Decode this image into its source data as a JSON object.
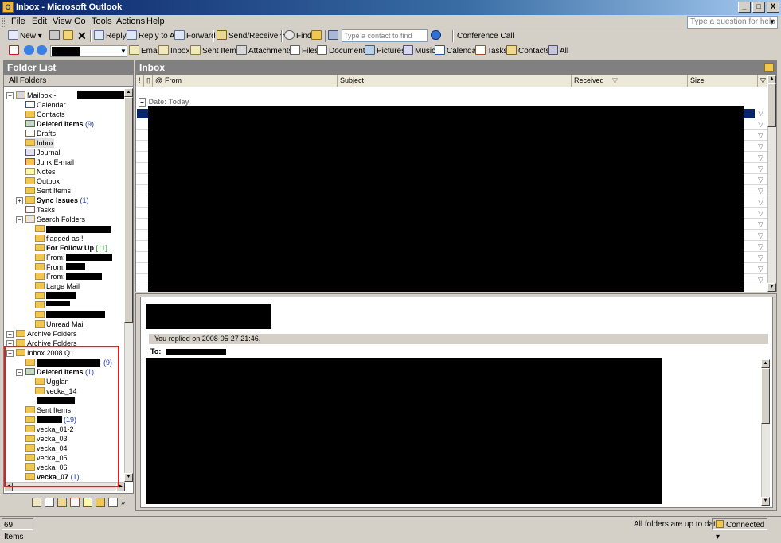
{
  "window": {
    "title": "Inbox - Microsoft Outlook",
    "min": "_",
    "max": "□",
    "close": "X"
  },
  "menu": {
    "items": [
      "File",
      "Edit",
      "View",
      "Go",
      "Tools",
      "Actions",
      "Help"
    ],
    "ask_placeholder": "Type a question for help"
  },
  "toolbar": {
    "new": "New",
    "reply": "Reply",
    "reply_all": "Reply to All",
    "forward": "Forward",
    "send_receive": "Send/Receive",
    "find": "Find",
    "contact_placeholder": "Type a contact to find",
    "conference": "Conference Call"
  },
  "navbar": {
    "items": [
      "Email",
      "Inbox",
      "Sent Items",
      "Attachments",
      "Files",
      "Documents",
      "Pictures",
      "Music",
      "Calendar",
      "Tasks",
      "Contacts",
      "All"
    ]
  },
  "folder_pane": {
    "title": "Folder List",
    "subtitle": "All Folders",
    "mailbox": "Mailbox -",
    "items": {
      "calendar": "Calendar",
      "contacts": "Contacts",
      "deleted": "Deleted Items",
      "deleted_count": "(9)",
      "drafts": "Drafts",
      "inbox": "Inbox",
      "journal": "Journal",
      "junk": "Junk E-mail",
      "notes": "Notes",
      "outbox": "Outbox",
      "sent": "Sent Items",
      "sync": "Sync Issues",
      "sync_count": "(1)",
      "tasks": "Tasks",
      "search": "Search Folders",
      "flagged": "flagged as !",
      "followup": "For Follow Up",
      "followup_count": "[11]",
      "from1": "From:",
      "from2": "From:",
      "from3": "From:",
      "large": "Large Mail",
      "unread": "Unread Mail",
      "archive1": "Archive Folders",
      "archive2": "Archive Folders"
    },
    "archive": {
      "root": "Inbox 2008 Q1",
      "first_count": "(9)",
      "deleted": "Deleted Items",
      "deleted_count": "(1)",
      "ugglan": "Ugglan",
      "vecka14": "vecka_14",
      "sent": "Sent Items",
      "folder_count": "(19)",
      "v01": "vecka_01-2",
      "v03": "vecka_03",
      "v04": "vecka_04",
      "v05": "vecka_05",
      "v06": "vecka_06",
      "v07": "vecka_07",
      "v07_count": "(1)"
    }
  },
  "inbox": {
    "title": "Inbox",
    "columns": {
      "from": "From",
      "subject": "Subject",
      "received": "Received",
      "size": "Size"
    },
    "group": "Date: Today"
  },
  "reading": {
    "replied": "You replied on 2008-05-27 21:46.",
    "to_label": "To:"
  },
  "status": {
    "count": "69 Items",
    "sync": "All folders are up to date.",
    "connection": "Connected"
  },
  "colors": {
    "title_bar": "#0a246a",
    "selection": "#0a246a",
    "highlight_box": "#e02020",
    "pane_header": "#808080"
  }
}
